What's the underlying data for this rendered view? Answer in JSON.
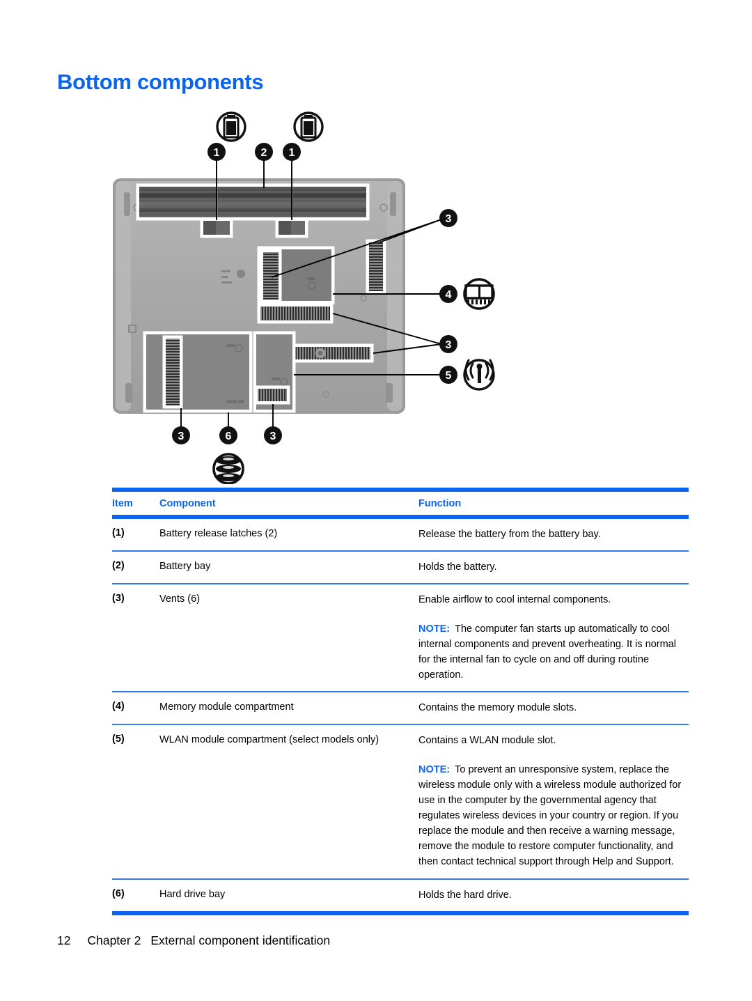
{
  "page": {
    "title": "Bottom components"
  },
  "figure": {
    "alt_name": "laptop-bottom-illustration",
    "callouts": [
      {
        "id": "c1a",
        "number": "1",
        "icon": "battery-icon"
      },
      {
        "id": "c2",
        "number": "2",
        "icon": null
      },
      {
        "id": "c1b",
        "number": "1",
        "icon": "battery-icon"
      },
      {
        "id": "c3a",
        "number": "3",
        "icon": null
      },
      {
        "id": "c4",
        "number": "4",
        "icon": "memory-module-icon"
      },
      {
        "id": "c3b",
        "number": "3",
        "icon": null
      },
      {
        "id": "c5",
        "number": "5",
        "icon": "wireless-antenna-icon"
      },
      {
        "id": "c3c",
        "number": "3",
        "icon": null
      },
      {
        "id": "c6",
        "number": "6",
        "icon": "hard-drive-icon"
      },
      {
        "id": "c3d",
        "number": "3",
        "icon": null
      }
    ]
  },
  "table": {
    "headers": {
      "item": "Item",
      "component": "Component",
      "function": "Function"
    },
    "note_label": "NOTE:",
    "rows": [
      {
        "item": "(1)",
        "component": "Battery release latches (2)",
        "function": "Release the battery from the battery bay.",
        "note": null
      },
      {
        "item": "(2)",
        "component": "Battery bay",
        "function": "Holds the battery.",
        "note": null
      },
      {
        "item": "(3)",
        "component": "Vents (6)",
        "function": "Enable airflow to cool internal components.",
        "note": "The computer fan starts up automatically to cool internal components and prevent overheating. It is normal for the internal fan to cycle on and off during routine operation."
      },
      {
        "item": "(4)",
        "component": "Memory module compartment",
        "function": "Contains the memory module slots.",
        "note": null
      },
      {
        "item": "(5)",
        "component": "WLAN module compartment (select models only)",
        "function": "Contains a WLAN module slot.",
        "note": "To prevent an unresponsive system, replace the wireless module only with a wireless module authorized for use in the computer by the governmental agency that regulates wireless devices in your country or region. If you replace the module and then receive a warning message, remove the module to restore computer functionality, and then contact technical support through Help and Support."
      },
      {
        "item": "(6)",
        "component": "Hard drive bay",
        "function": "Holds the hard drive.",
        "note": null
      }
    ]
  },
  "footer": {
    "page_number": "12",
    "chapter": "Chapter 2",
    "chapter_title": "External component identification"
  },
  "colors": {
    "accent_blue": "#0A64F0",
    "rule_blue": "#2E79F2",
    "text": "#000000",
    "background": "#ffffff"
  }
}
